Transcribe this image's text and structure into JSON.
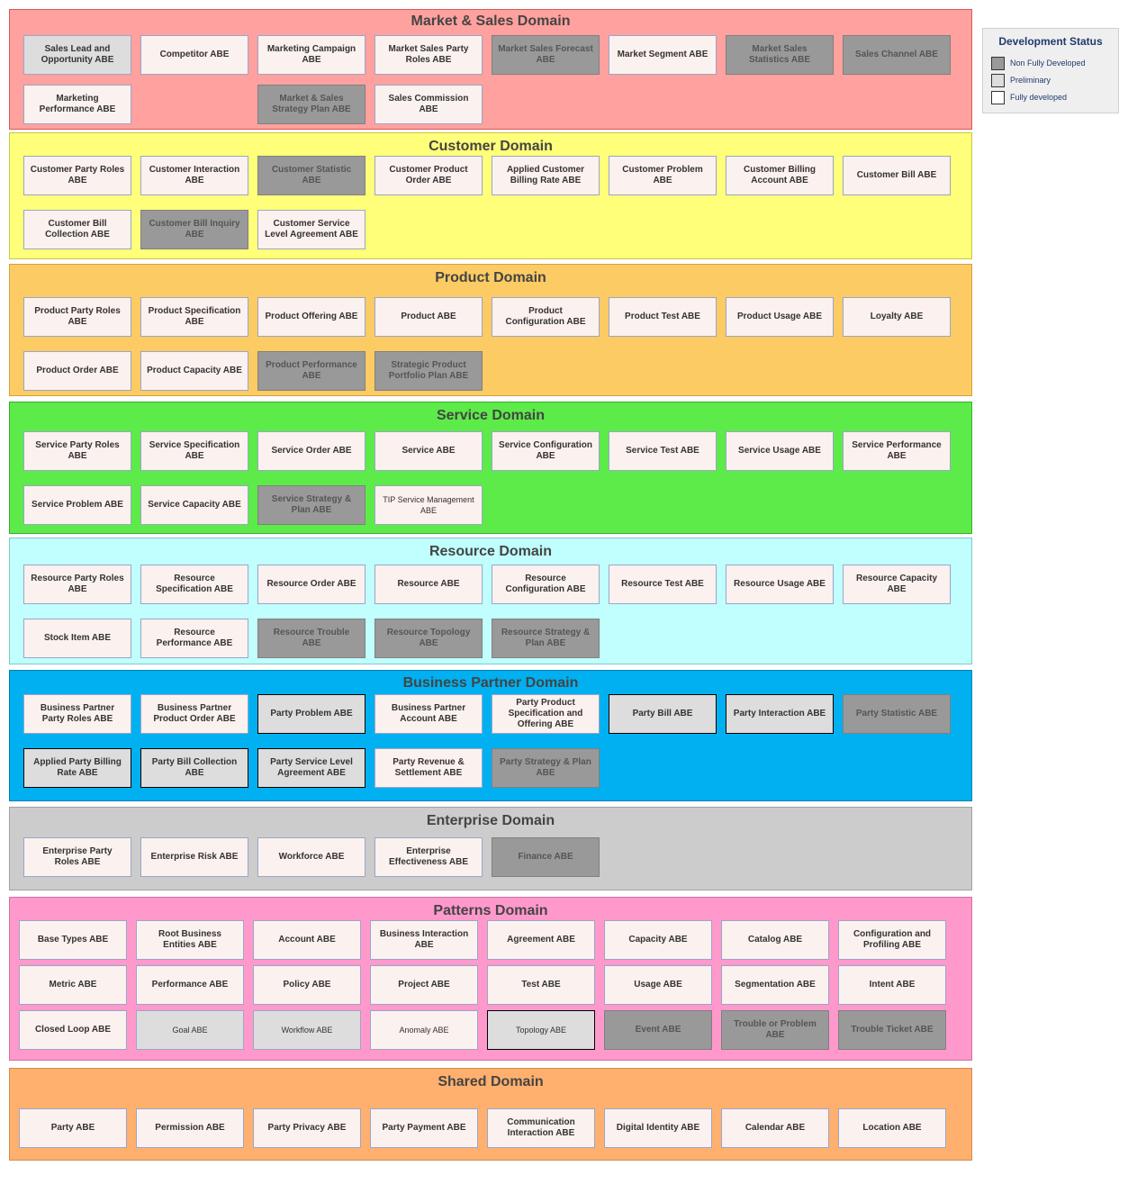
{
  "colors": {
    "nonfully": "#999999",
    "preliminary": "#dddddd",
    "fully": "#fbf1ee"
  },
  "legend": {
    "title": "Development Status",
    "items": [
      {
        "label": "Non Fully Developed",
        "color": "#999999"
      },
      {
        "label": "Preliminary",
        "color": "#dddddd"
      },
      {
        "label": "Fully developed",
        "color": "#ffffff"
      }
    ]
  },
  "domains": [
    {
      "title": "Market & Sales Domain",
      "bg": "#ffa19e",
      "border": "#d95a5a",
      "abes": [
        {
          "label": "Sales Lead and Opportunity ABE",
          "status": "preliminary"
        },
        {
          "label": "Competitor ABE",
          "status": "fully"
        },
        {
          "label": "Marketing Campaign ABE",
          "status": "fully"
        },
        {
          "label": "Market Sales Party Roles ABE",
          "status": "fully"
        },
        {
          "label": "Market Sales Forecast ABE",
          "status": "nonfully"
        },
        {
          "label": "Market Segment ABE",
          "status": "fully"
        },
        {
          "label": "Market Sales Statistics ABE",
          "status": "nonfully"
        },
        {
          "label": "Sales Channel ABE",
          "status": "nonfully"
        },
        {
          "label": "Marketing Performance ABE",
          "status": "fully"
        },
        {
          "label": "Market & Sales Strategy Plan ABE",
          "status": "nonfully"
        },
        {
          "label": "Sales Commission ABE",
          "status": "fully"
        }
      ]
    },
    {
      "title": "Customer Domain",
      "bg": "#ffff7a",
      "border": "#c8c84a",
      "abes": [
        {
          "label": "Customer Party Roles ABE",
          "status": "fully"
        },
        {
          "label": "Customer Interaction ABE",
          "status": "fully"
        },
        {
          "label": "Customer Statistic ABE",
          "status": "nonfully"
        },
        {
          "label": "Customer Product Order ABE",
          "status": "fully"
        },
        {
          "label": "Applied Customer Billing Rate ABE",
          "status": "fully"
        },
        {
          "label": "Customer Problem ABE",
          "status": "fully"
        },
        {
          "label": "Customer Billing Account ABE",
          "status": "fully"
        },
        {
          "label": "Customer Bill ABE",
          "status": "fully"
        },
        {
          "label": "Customer Bill Collection ABE",
          "status": "fully"
        },
        {
          "label": "Customer Bill Inquiry ABE",
          "status": "nonfully"
        },
        {
          "label": "Customer Service Level Agreement ABE",
          "status": "fully"
        }
      ]
    },
    {
      "title": "Product Domain",
      "bg": "#fccb63",
      "border": "#d4a040",
      "abes": [
        {
          "label": "Product Party Roles ABE",
          "status": "fully"
        },
        {
          "label": "Product Specification ABE",
          "status": "fully"
        },
        {
          "label": "Product Offering ABE",
          "status": "fully"
        },
        {
          "label": "Product ABE",
          "status": "fully"
        },
        {
          "label": "Product Configuration ABE",
          "status": "fully"
        },
        {
          "label": "Product Test ABE",
          "status": "fully"
        },
        {
          "label": "Product Usage ABE",
          "status": "fully"
        },
        {
          "label": "Loyalty ABE",
          "status": "fully"
        },
        {
          "label": "Product Order ABE",
          "status": "fully"
        },
        {
          "label": "Product Capacity ABE",
          "status": "fully"
        },
        {
          "label": "Product Performance ABE",
          "status": "nonfully"
        },
        {
          "label": "Strategic Product Portfolio Plan ABE",
          "status": "nonfully"
        }
      ]
    },
    {
      "title": "Service Domain",
      "bg": "#5deb49",
      "border": "#3eaa30",
      "abes": [
        {
          "label": "Service Party Roles ABE",
          "status": "fully"
        },
        {
          "label": "Service Specification ABE",
          "status": "fully"
        },
        {
          "label": "Service Order ABE",
          "status": "fully"
        },
        {
          "label": "Service ABE",
          "status": "fully"
        },
        {
          "label": "Service Configuration ABE",
          "status": "fully"
        },
        {
          "label": "Service Test ABE",
          "status": "fully"
        },
        {
          "label": "Service Usage ABE",
          "status": "fully"
        },
        {
          "label": "Service Performance ABE",
          "status": "fully"
        },
        {
          "label": "Service Problem ABE",
          "status": "fully"
        },
        {
          "label": "Service Capacity ABE",
          "status": "fully"
        },
        {
          "label": "Service Strategy & Plan ABE",
          "status": "nonfully"
        },
        {
          "label": "TIP Service Management ABE",
          "status": "fully",
          "small": true
        }
      ]
    },
    {
      "title": "Resource Domain",
      "bg": "#c0fffd",
      "border": "#80c8c8",
      "abes": [
        {
          "label": "Resource Party Roles ABE",
          "status": "fully"
        },
        {
          "label": "Resource Specification ABE",
          "status": "fully"
        },
        {
          "label": "Resource Order ABE",
          "status": "fully"
        },
        {
          "label": "Resource ABE",
          "status": "fully"
        },
        {
          "label": "Resource Configuration ABE",
          "status": "fully"
        },
        {
          "label": "Resource Test ABE",
          "status": "fully"
        },
        {
          "label": "Resource Usage ABE",
          "status": "fully"
        },
        {
          "label": "Resource Capacity ABE",
          "status": "fully"
        },
        {
          "label": "Stock Item ABE",
          "status": "fully"
        },
        {
          "label": "Resource Performance ABE",
          "status": "fully"
        },
        {
          "label": "Resource Trouble ABE",
          "status": "nonfully"
        },
        {
          "label": "Resource Topology ABE",
          "status": "nonfully"
        },
        {
          "label": "Resource Strategy & Plan ABE",
          "status": "nonfully"
        }
      ]
    },
    {
      "title": "Business Partner Domain",
      "bg": "#00b0f0",
      "border": "#0080b0",
      "abes": [
        {
          "label": "Business Partner Party Roles ABE",
          "status": "fully"
        },
        {
          "label": "Business Partner Product Order ABE",
          "status": "fully"
        },
        {
          "label": "Party Problem ABE",
          "status": "preliminary",
          "darkBorder": true
        },
        {
          "label": "Business Partner Account ABE",
          "status": "fully"
        },
        {
          "label": "Party Product Specification and Offering ABE",
          "status": "fully"
        },
        {
          "label": "Party Bill ABE",
          "status": "preliminary",
          "darkBorder": true
        },
        {
          "label": "Party Interaction ABE",
          "status": "preliminary",
          "darkBorder": true
        },
        {
          "label": "Party Statistic ABE",
          "status": "nonfully"
        },
        {
          "label": "Applied Party Billing Rate ABE",
          "status": "preliminary",
          "darkBorder": true
        },
        {
          "label": "Party Bill Collection ABE",
          "status": "preliminary",
          "darkBorder": true
        },
        {
          "label": "Party Service Level Agreement ABE",
          "status": "preliminary",
          "darkBorder": true
        },
        {
          "label": "Party Revenue & Settlement ABE",
          "status": "fully"
        },
        {
          "label": "Party Strategy & Plan ABE",
          "status": "nonfully"
        }
      ]
    },
    {
      "title": "Enterprise Domain",
      "bg": "#cccccc",
      "border": "#a0a0a0",
      "abes": [
        {
          "label": "Enterprise Party Roles ABE",
          "status": "fully"
        },
        {
          "label": "Enterprise Risk ABE",
          "status": "fully"
        },
        {
          "label": "Workforce ABE",
          "status": "fully"
        },
        {
          "label": "Enterprise Effectiveness ABE",
          "status": "fully"
        },
        {
          "label": "Finance ABE",
          "status": "nonfully"
        }
      ]
    },
    {
      "title": "Patterns Domain",
      "bg": "#ff99cc",
      "border": "#d070a0",
      "abes": [
        {
          "label": "Base Types ABE",
          "status": "fully"
        },
        {
          "label": "Root Business Entities ABE",
          "status": "fully"
        },
        {
          "label": "Account ABE",
          "status": "fully"
        },
        {
          "label": "Business Interaction ABE",
          "status": "fully"
        },
        {
          "label": "Agreement ABE",
          "status": "fully"
        },
        {
          "label": "Capacity ABE",
          "status": "fully"
        },
        {
          "label": "Catalog ABE",
          "status": "fully"
        },
        {
          "label": "Configuration and Profiling ABE",
          "status": "fully"
        },
        {
          "label": "Metric ABE",
          "status": "fully"
        },
        {
          "label": "Performance ABE",
          "status": "fully"
        },
        {
          "label": "Policy ABE",
          "status": "fully"
        },
        {
          "label": "Project ABE",
          "status": "fully"
        },
        {
          "label": "Test ABE",
          "status": "fully"
        },
        {
          "label": "Usage ABE",
          "status": "fully"
        },
        {
          "label": "Segmentation ABE",
          "status": "fully"
        },
        {
          "label": "Intent ABE",
          "status": "fully"
        },
        {
          "label": "Closed Loop ABE",
          "status": "fully"
        },
        {
          "label": "Goal ABE",
          "status": "preliminary",
          "small": true
        },
        {
          "label": "Workflow ABE",
          "status": "preliminary",
          "small": true
        },
        {
          "label": "Anomaly ABE",
          "status": "fully",
          "small": true
        },
        {
          "label": "Topology ABE",
          "status": "preliminary",
          "small": true,
          "darkBorder": true
        },
        {
          "label": "Event ABE",
          "status": "nonfully"
        },
        {
          "label": "Trouble or Problem ABE",
          "status": "nonfully"
        },
        {
          "label": "Trouble Ticket ABE",
          "status": "nonfully"
        }
      ]
    },
    {
      "title": "Shared Domain",
      "bg": "#ffb06e",
      "border": "#d48a50",
      "abes": [
        {
          "label": "Party ABE",
          "status": "fully"
        },
        {
          "label": "Permission ABE",
          "status": "fully"
        },
        {
          "label": "Party Privacy ABE",
          "status": "fully"
        },
        {
          "label": "Party Payment ABE",
          "status": "fully"
        },
        {
          "label": "Communication Interaction ABE",
          "status": "fully"
        },
        {
          "label": "Digital Identity ABE",
          "status": "fully"
        },
        {
          "label": "Calendar ABE",
          "status": "fully"
        },
        {
          "label": "Location ABE",
          "status": "fully"
        }
      ]
    }
  ]
}
